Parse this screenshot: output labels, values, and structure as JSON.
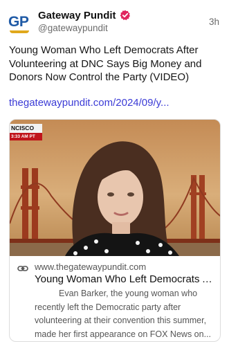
{
  "post": {
    "display_name": "Gateway Pundit",
    "handle": "@gatewaypundit",
    "timestamp": "3h",
    "avatar_text": "GP",
    "text": "Young Woman Who Left Democrats After Volunteering at DNC Says Big Money and Donors Now Control the Party (VIDEO)",
    "link_text": "thegatewaypundit.com/2024/09/y..."
  },
  "card": {
    "chyron_city": "NCISCO",
    "chyron_time": "3:33 AM PT",
    "domain": "www.thegatewaypundit.com",
    "title": "Young Woman Who Left Democrats A...",
    "description": "Evan Barker, the young woman who recently left the Democratic party after volunteering at their convention this summer, made her first appearance on FOX News on..."
  },
  "icons": {
    "verified": "verified-badge-icon",
    "link": "link-icon"
  },
  "colors": {
    "link": "#3b3bd6",
    "verified": "#e0245e",
    "avatar_blue": "#1f5aa6",
    "avatar_gold": "#e0a81c",
    "chyron_red": "#c0141b"
  }
}
